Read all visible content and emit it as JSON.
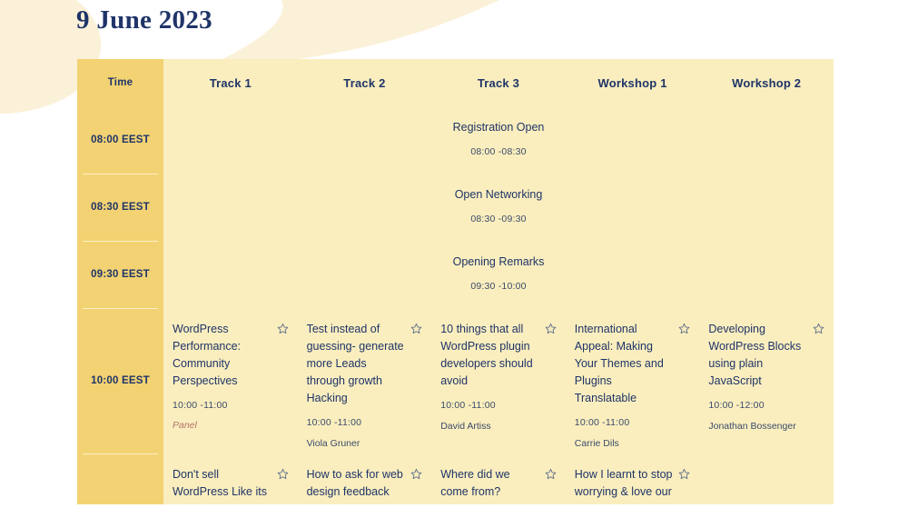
{
  "page": {
    "title": "9 June 2023",
    "accent_gold": "#f2d272",
    "body_cream": "#faeebe",
    "navy": "#1f3468",
    "tag_color": "#b5736a",
    "blob_color": "#fbf1d8"
  },
  "table": {
    "columns": [
      "Time",
      "Track 1",
      "Track 2",
      "Track 3",
      "Workshop 1",
      "Workshop 2"
    ],
    "rows": [
      {
        "time": "08:00 EEST",
        "kind": "plenary",
        "session": {
          "title": "Registration Open",
          "time": "08:00 -08:30"
        }
      },
      {
        "time": "08:30 EEST",
        "kind": "plenary",
        "session": {
          "title": "Open Networking",
          "time": "08:30 -09:30"
        }
      },
      {
        "time": "09:30 EEST",
        "kind": "plenary",
        "session": {
          "title": "Opening Remarks",
          "time": "09:30 -10:00"
        }
      },
      {
        "time": "10:00 EEST",
        "kind": "tracks",
        "sessions": [
          {
            "title": "WordPress Performance: Community Perspectives",
            "time": "10:00 -11:00",
            "speaker": "",
            "tag": "Panel",
            "star": "star-icon"
          },
          {
            "title": "Test instead of guessing- generate more Leads through growth Hacking",
            "time": "10:00 -11:00",
            "speaker": "Viola Gruner",
            "tag": "",
            "star": "star-icon"
          },
          {
            "title": "10 things that all WordPress plugin developers should avoid",
            "time": "10:00 -11:00",
            "speaker": "David Artiss",
            "tag": "",
            "star": "star-icon"
          },
          {
            "title": "International Appeal: Making Your Themes and Plugins Translatable",
            "time": "10:00 -11:00",
            "speaker": "Carrie Dils",
            "tag": "",
            "star": "star-icon"
          },
          {
            "title": "Developing WordPress Blocks using plain JavaScript",
            "time": "10:00 -12:00",
            "speaker": "Jonathan Bossenger",
            "tag": "",
            "star": "star-icon"
          }
        ]
      },
      {
        "time": "",
        "kind": "tracks",
        "sessions": [
          {
            "title": "Don't sell WordPress Like its",
            "time": "",
            "speaker": "",
            "tag": "",
            "star": "star-icon"
          },
          {
            "title": "How to ask for web design feedback",
            "time": "",
            "speaker": "",
            "tag": "",
            "star": "star-icon"
          },
          {
            "title": "Where did we come from?",
            "time": "",
            "speaker": "",
            "tag": "",
            "star": "star-icon"
          },
          {
            "title": "How I learnt to stop worrying & love our",
            "time": "",
            "speaker": "",
            "tag": "",
            "star": "star-icon"
          },
          {
            "title": "",
            "time": "",
            "speaker": "",
            "tag": "",
            "star": ""
          }
        ]
      }
    ]
  }
}
